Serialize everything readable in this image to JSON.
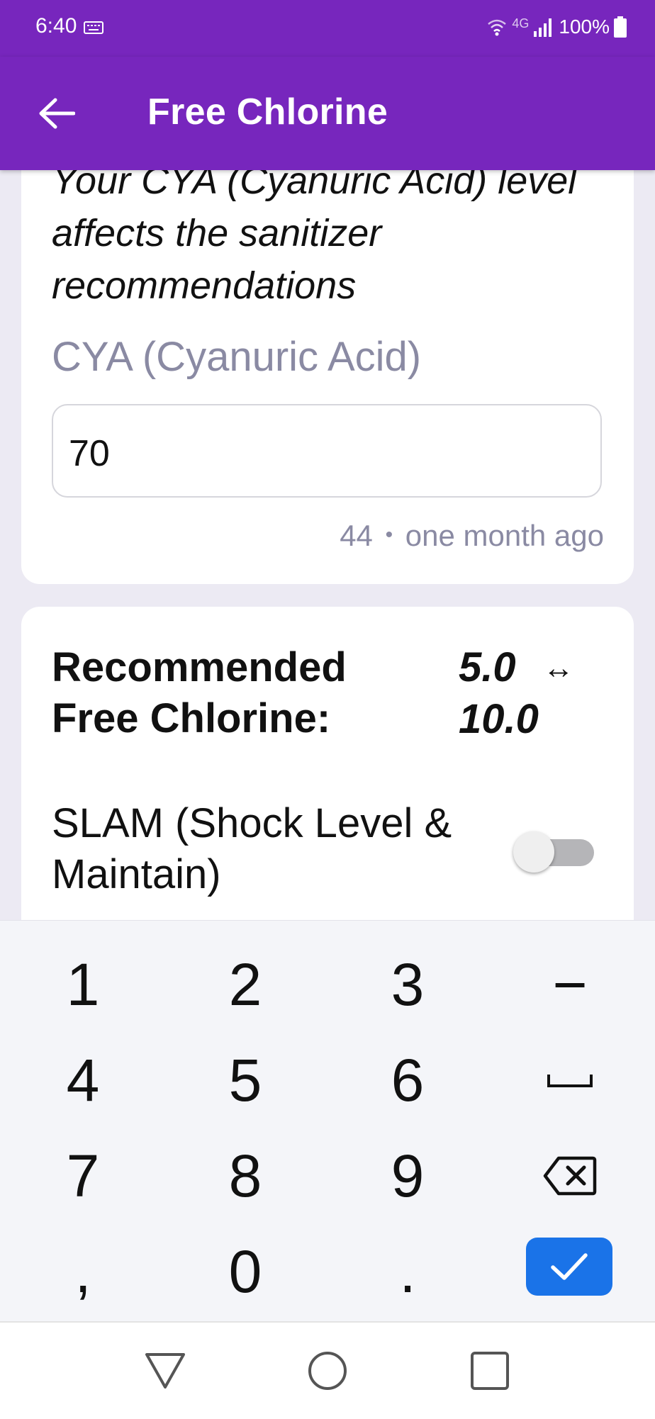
{
  "status_bar": {
    "time": "6:40",
    "network": "4G",
    "battery": "100%"
  },
  "app_bar": {
    "title": "Free Chlorine",
    "back_icon": "arrow-left-icon"
  },
  "cya_card": {
    "description": "Your CYA (Cyanuric Acid) level affects the sanitizer recommendations",
    "field_label": "CYA (Cyanuric Acid)",
    "field_value": "70",
    "history_value": "44",
    "history_separator": "•",
    "history_time": "one month ago"
  },
  "recommendation_card": {
    "label_line1": "Recommended",
    "label_line2": "Free Chlorine:",
    "range_low": "5.0",
    "range_icon": "↔",
    "range_high": "10.0",
    "slam_label": "SLAM (Shock Level & Maintain)",
    "slam_enabled": false
  },
  "keyboard": {
    "keys": [
      "1",
      "2",
      "3",
      "−",
      "4",
      "5",
      "6",
      "␣",
      "7",
      "8",
      "9",
      "backspace",
      ",",
      "0",
      ".",
      "done"
    ],
    "done_color": "#1a73e8"
  },
  "nav_bar": {
    "back_icon": "triangle-back-icon",
    "home_icon": "circle-home-icon",
    "recents_icon": "square-recents-icon"
  },
  "colors": {
    "primary": "#7726bd",
    "background": "#eceaf3",
    "muted_text": "#8a8aa3"
  }
}
